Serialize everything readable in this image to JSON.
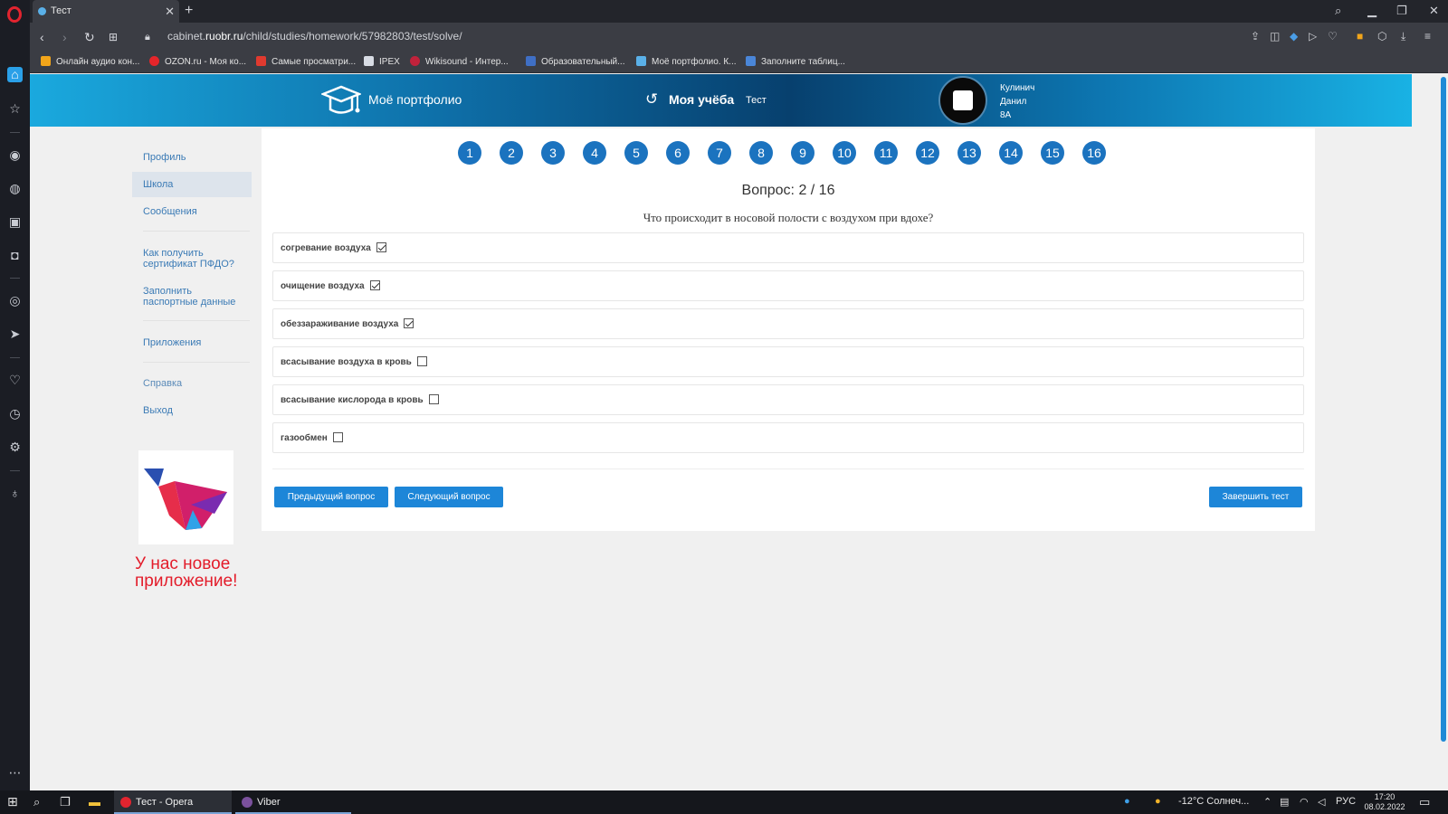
{
  "browser": {
    "tab_title": "Тест",
    "tab_close": "✕",
    "new_tab": "+",
    "url_prefix": "cabinet.",
    "url_host": "ruobr.ru",
    "url_path": "/child/studies/homework/57982803/test/solve/",
    "bookmarks": [
      {
        "label": "Онлайн аудио кон...",
        "color": "#f2a51a"
      },
      {
        "label": "OZON.ru - Моя ко...",
        "color": "#e5252a"
      },
      {
        "label": "Самые просматри...",
        "color": "#e03a2f"
      },
      {
        "label": "IPEX",
        "color": "#d8dce4"
      },
      {
        "label": "Wikisound - Интер...",
        "color": "#c0223b"
      },
      {
        "label": "Образовательный...",
        "color": "#3f6fc5"
      },
      {
        "label": "Моё портфолио. К...",
        "color": "#5ab0e8"
      },
      {
        "label": "Заполните таблиц...",
        "color": "#4a86d8"
      }
    ]
  },
  "header": {
    "portfolio": "Моё портфолио",
    "study": "Моя учёба",
    "crumb": "Тест",
    "user_last": "Кулинич",
    "user_first": "Данил",
    "user_class": "8А"
  },
  "sidebar": {
    "profile": "Профиль",
    "school": "Школа",
    "messages": "Сообщения",
    "pfdo_1": "Как получить",
    "pfdo_2": "сертификат ПФДО?",
    "passport_1": "Заполнить",
    "passport_2": "паспортные данные",
    "apps": "Приложения",
    "help": "Справка",
    "logout": "Выход",
    "promo_1": "У нас новое",
    "promo_2": "приложение!"
  },
  "test": {
    "question_numbers": [
      "1",
      "2",
      "3",
      "4",
      "5",
      "6",
      "7",
      "8",
      "9",
      "10",
      "11",
      "12",
      "13",
      "14",
      "15",
      "16"
    ],
    "counter": "Вопрос: 2 / 16",
    "question": "Что происходит в носовой полости с воздухом при вдохе?",
    "answers": [
      {
        "label": "согревание воздуха",
        "checked": true
      },
      {
        "label": "очищение воздуха",
        "checked": true
      },
      {
        "label": "обеззараживание воздуха",
        "checked": true
      },
      {
        "label": "всасывание воздуха в кровь",
        "checked": false
      },
      {
        "label": "всасывание кислорода в кровь",
        "checked": false
      },
      {
        "label": "газообмен",
        "checked": false
      }
    ],
    "prev": "Предыдущий вопрос",
    "next": "Следующий вопрос",
    "finish": "Завершить тест"
  },
  "taskbar": {
    "opera_app": "Тест - Opera",
    "viber_app": "Viber",
    "weather": "-12°C  Солнеч...",
    "lang": "РУС",
    "time": "17:20",
    "date": "08.02.2022"
  },
  "colors": {
    "accent": "#1d86d8",
    "question_circle": "#1b73bf",
    "promo": "#e31c2a",
    "link": "#3a7ab5"
  }
}
